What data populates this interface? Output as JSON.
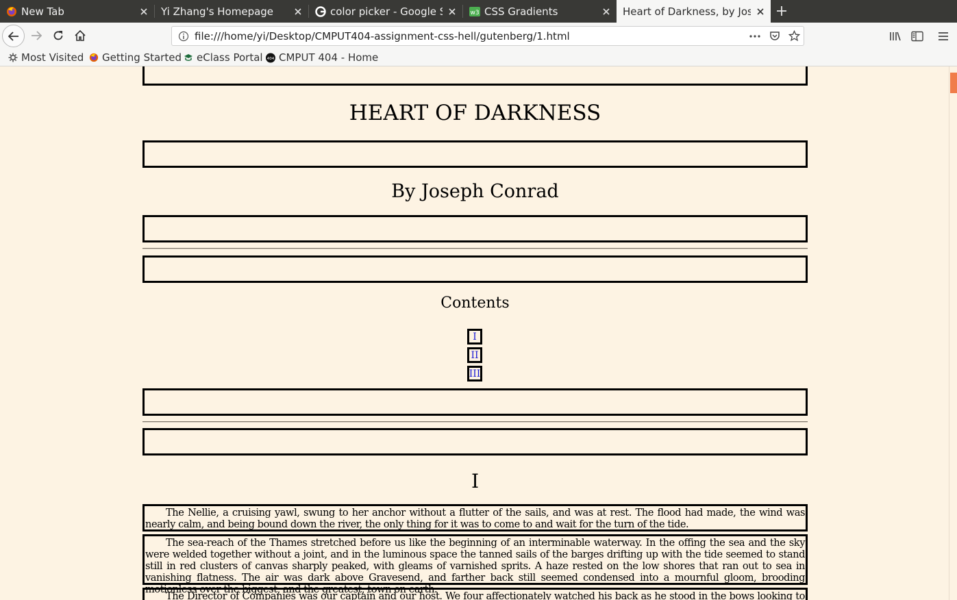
{
  "browser": {
    "tabs": [
      {
        "title": "New Tab",
        "icon": "firefox-icon",
        "active": false
      },
      {
        "title": "Yi Zhang's Homepage",
        "icon": "",
        "active": false
      },
      {
        "title": "color picker - Google Search",
        "icon": "google-icon",
        "active": false
      },
      {
        "title": "CSS Gradients",
        "icon": "w3schools-icon",
        "active": false
      },
      {
        "title": "Heart of Darkness, by Joseph Conrad",
        "icon": "",
        "active": true
      }
    ],
    "url": "file:///home/yi/Desktop/CMPUT404-assignment-css-hell/gutenberg/1.html",
    "bookmarks": [
      {
        "label": "Most Visited",
        "icon": "gear-icon"
      },
      {
        "label": "Getting Started",
        "icon": "firefox-icon"
      },
      {
        "label": "eClass Portal",
        "icon": "eclass-icon"
      },
      {
        "label": "CMPUT 404 - Home",
        "icon": "404-icon"
      }
    ],
    "colors": {
      "tabstrip": "#393936",
      "toolbar": "#f6f6f5",
      "page_bg": "#fdf3e3",
      "link": "#1a1ad6",
      "scroll_thumb": "#f07d4a"
    }
  },
  "page": {
    "title": "HEART OF DARKNESS",
    "author": "By Joseph Conrad",
    "contents_heading": "Contents",
    "toc": [
      "I",
      "II",
      "III"
    ],
    "chapter_heading": "I",
    "paragraphs": [
      "The Nellie, a cruising yawl, swung to her anchor without a flutter of the sails, and was at rest. The flood had made, the wind was nearly calm, and being bound down the river, the only thing for it was to come to and wait for the turn of the tide.",
      "The sea-reach of the Thames stretched before us like the beginning of an interminable waterway. In the offing the sea and the sky were welded together without a joint, and in the luminous space the tanned sails of the barges drifting up with the tide seemed to stand still in red clusters of canvas sharply peaked, with gleams of varnished sprits. A haze rested on the low shores that ran out to sea in vanishing flatness. The air was dark above Gravesend, and farther back still seemed condensed into a mournful gloom, brooding motionless over the biggest, and the greatest, town on earth.",
      "The Director of Companies was our captain and our host. We four affectionately watched his back as he stood in the bows looking to seaward. On"
    ]
  }
}
